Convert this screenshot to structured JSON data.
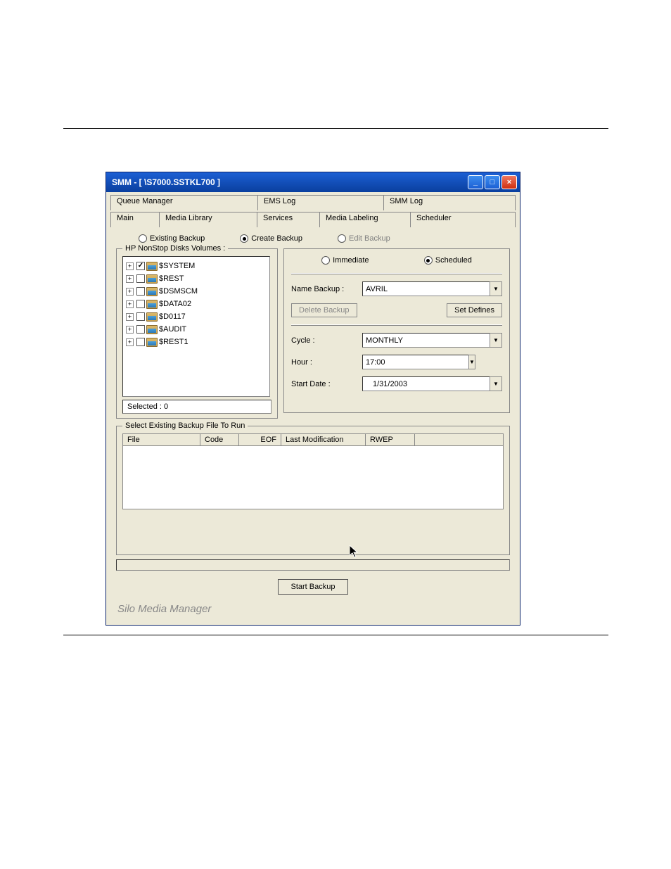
{
  "page_link_text": "",
  "window_title": "SMM - [ \\S7000.SSTKL700 ]",
  "titlebar": {
    "min_label": "_",
    "max_label": "□",
    "close_label": "×"
  },
  "tabs_row1": [
    "Queue Manager",
    "EMS Log",
    "SMM Log"
  ],
  "tabs_row2": [
    "Main",
    "Media Library",
    "Services",
    "Media Labeling",
    "Scheduler"
  ],
  "backup_mode_radios": {
    "existing": "Existing Backup",
    "create": "Create Backup",
    "edit": "Edit Backup",
    "selected": "create",
    "edit_disabled": true
  },
  "volumes_fieldset_label": "HP NonStop Disks Volumes :",
  "volumes": [
    {
      "name": "$SYSTEM",
      "checked": true
    },
    {
      "name": "$REST",
      "checked": false
    },
    {
      "name": "$DSMSCM",
      "checked": false
    },
    {
      "name": "$DATA02",
      "checked": false
    },
    {
      "name": "$D0117",
      "checked": false
    },
    {
      "name": "$AUDIT",
      "checked": false
    },
    {
      "name": "$REST1",
      "checked": false
    }
  ],
  "selected_count_label": "Selected : 0",
  "timing_radios": {
    "immediate": "Immediate",
    "scheduled": "Scheduled",
    "selected": "scheduled"
  },
  "form": {
    "name_label": "Name Backup :",
    "name_value": "AVRIL",
    "delete_btn": "Delete Backup",
    "set_defines_btn": "Set Defines",
    "cycle_label": "Cycle :",
    "cycle_value": "MONTHLY",
    "hour_label": "Hour :",
    "hour_value": "17:00",
    "start_date_label": "Start Date :",
    "start_date_value": "1/31/2003"
  },
  "run_fieldset_label": "Select Existing Backup File To Run",
  "list_columns": [
    "File",
    "Code",
    "EOF",
    "Last Modification",
    "RWEP"
  ],
  "start_backup_label": "Start Backup",
  "footer_brand": "Silo Media Manager"
}
